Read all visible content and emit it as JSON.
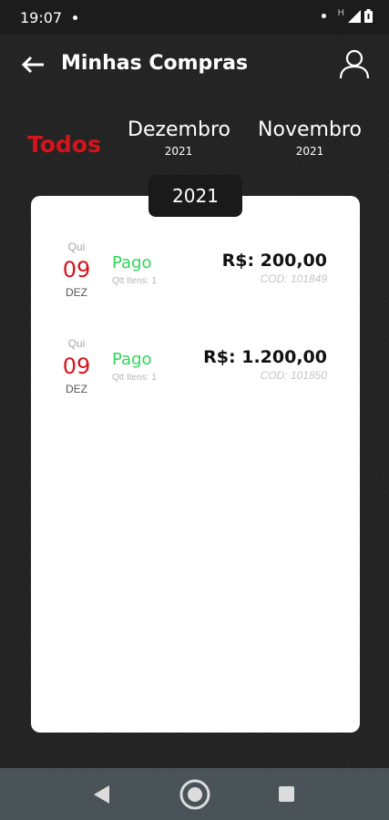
{
  "status_bar": {
    "time": "19:07",
    "network_label": "H"
  },
  "app_bar": {
    "title": "Minhas Compras",
    "back_icon": "arrow-left-icon",
    "profile_icon": "user-icon"
  },
  "filters": {
    "all_label": "Todos",
    "tabs": [
      {
        "month": "Dezembro",
        "year": "2021"
      },
      {
        "month": "Novembro",
        "year": "2021"
      }
    ]
  },
  "card": {
    "year": "2021",
    "purchases": [
      {
        "weekday": "Qui",
        "day": "09",
        "month": "DEZ",
        "status": "Pago",
        "items": "Qtt Itens: 1",
        "amount": "R$: 200,00",
        "code": "COD: 101849"
      },
      {
        "weekday": "Qui",
        "day": "09",
        "month": "DEZ",
        "status": "Pago",
        "items": "Qtt Itens: 1",
        "amount": "R$: 1.200,00",
        "code": "COD: 101850"
      }
    ]
  },
  "colors": {
    "accent_red": "#d6141c",
    "status_green": "#2ed65a",
    "nav_bar": "#495358"
  },
  "nav_bar": {
    "icons": [
      "triangle-back-icon",
      "circle-home-icon",
      "square-recents-icon"
    ]
  }
}
